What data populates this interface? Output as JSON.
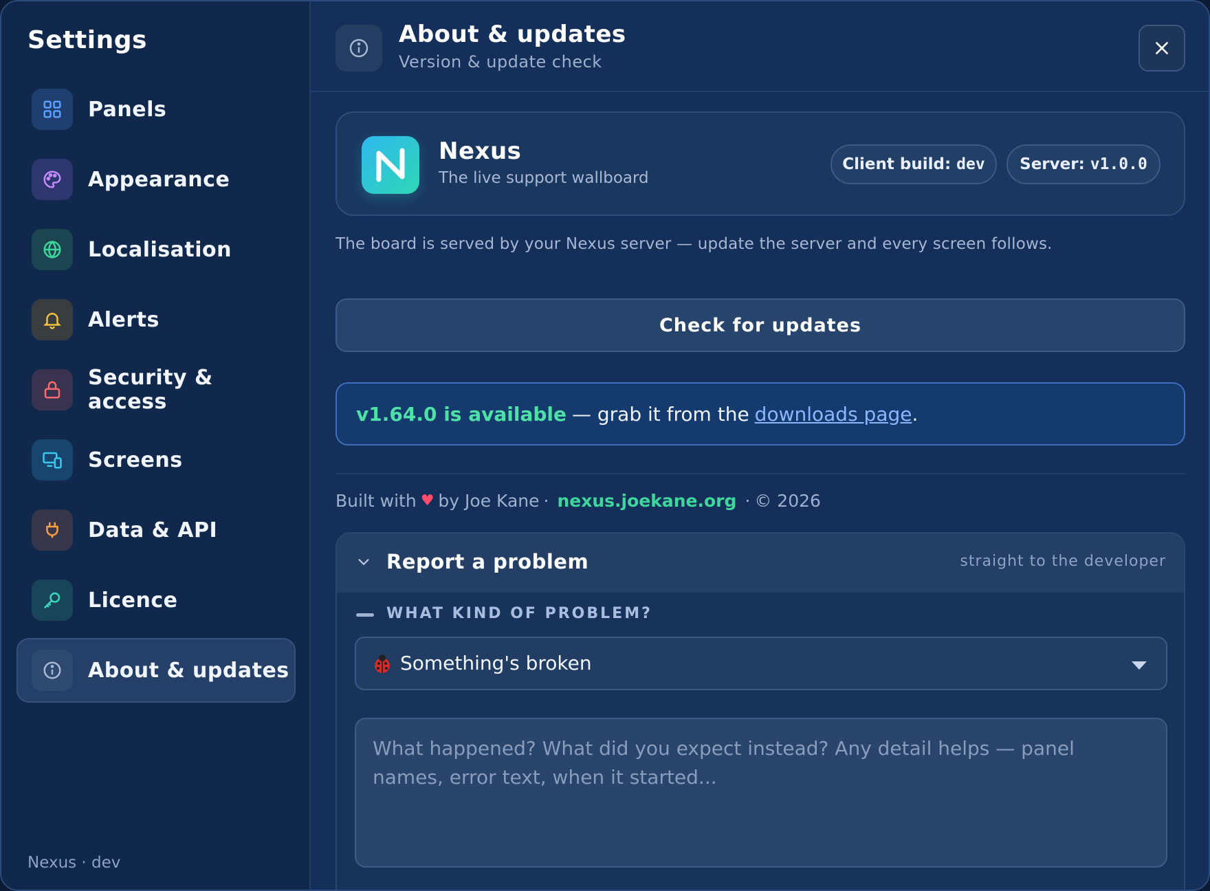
{
  "sidebar": {
    "title": "Settings",
    "items": [
      {
        "label": "Panels",
        "icon": "grid-icon",
        "color": "#5aa0ff",
        "bg": "#1f3f70"
      },
      {
        "label": "Appearance",
        "icon": "palette-icon",
        "color": "#c58cff",
        "bg": "#2e3670"
      },
      {
        "label": "Localisation",
        "icon": "globe-icon",
        "color": "#3fd69c",
        "bg": "#1b4550"
      },
      {
        "label": "Alerts",
        "icon": "bell-icon",
        "color": "#f0c040",
        "bg": "#3a3d3f"
      },
      {
        "label": "Security & access",
        "icon": "lock-icon",
        "color": "#ff6b6b",
        "bg": "#3a3350"
      },
      {
        "label": "Screens",
        "icon": "devices-icon",
        "color": "#38c8f0",
        "bg": "#17456e"
      },
      {
        "label": "Data & API",
        "icon": "plug-icon",
        "color": "#ff9f43",
        "bg": "#37364a"
      },
      {
        "label": "Licence",
        "icon": "key-icon",
        "color": "#3fd6c0",
        "bg": "#18455a"
      },
      {
        "label": "About & updates",
        "icon": "info-icon",
        "color": "#a9b8d3",
        "bg": "#2f4a70",
        "active": true
      }
    ],
    "footer": "Nexus · dev"
  },
  "header": {
    "title": "About & updates",
    "subtitle": "Version & update check",
    "close_icon": "close-icon"
  },
  "app": {
    "name": "Nexus",
    "tagline": "The live support wallboard",
    "logo_letter": "N",
    "client_build_label": "Client build:",
    "client_build_value": "dev",
    "server_label": "Server:",
    "server_value": "v1.0.0"
  },
  "served_text": "The board is served by your Nexus server — update the server and every screen follows.",
  "check_button": "Check for updates",
  "update": {
    "version_text": "v1.64.0 is available",
    "middle_text": "— grab it from the",
    "link_text": "downloads page",
    "end_text": "."
  },
  "credits": {
    "built_with": "Built with",
    "heart": "♥",
    "by": "by Joe Kane",
    "sep1": "·",
    "site": "nexus.joekane.org",
    "sep2": "·",
    "copyright": "© 2026"
  },
  "report": {
    "title": "Report a problem",
    "hint": "straight to the developer",
    "kind_label": "WHAT KIND OF PROBLEM?",
    "kind_value": "Something's broken",
    "description_placeholder": "What happened? What did you expect instead? Any detail helps — panel names, error text, when it started...",
    "description_value": ""
  },
  "colors": {
    "accent_green": "#4fe0a8",
    "link_blue": "#8cb7ff",
    "heart_red": "#ff4d6d",
    "site_green": "#3fd69c"
  }
}
